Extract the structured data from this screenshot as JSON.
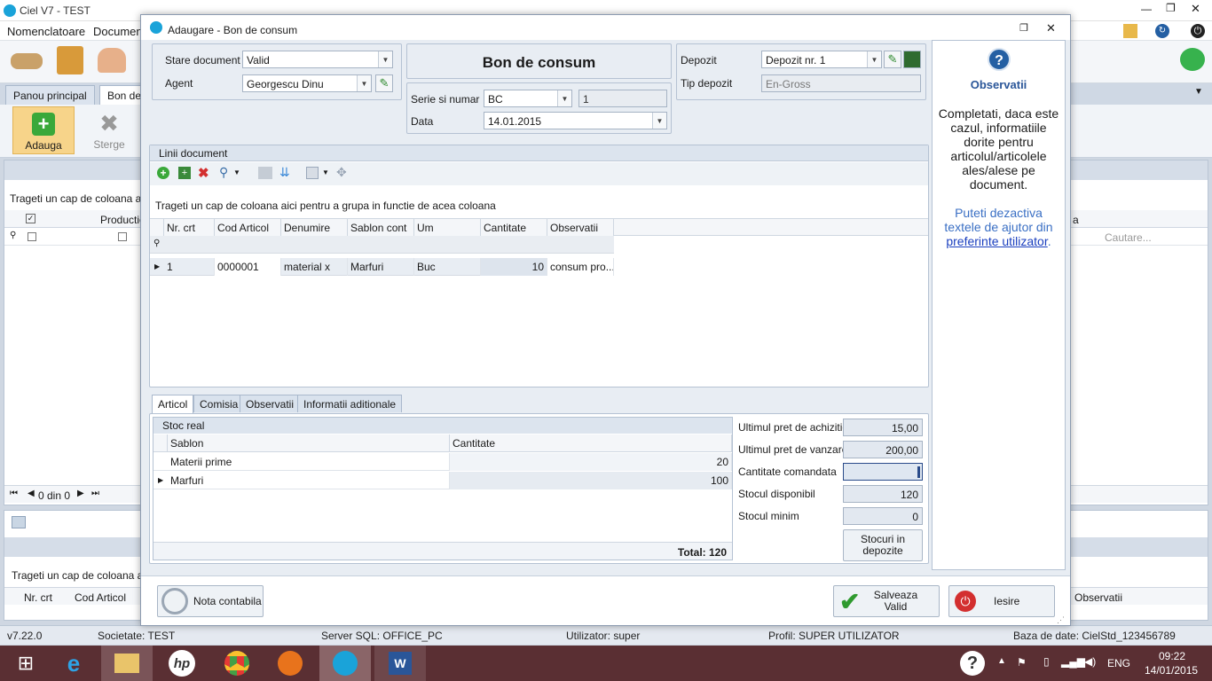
{
  "app": {
    "title": "Ciel V7 - TEST",
    "menu": [
      "Nomenclatoare",
      "Documen"
    ],
    "tabs": [
      "Panou principal",
      "Bon de c"
    ],
    "ribbon": {
      "add_label": "Adauga",
      "delete_label": "Sterge"
    },
    "left_panel": {
      "group_hint": "Trageti un cap de coloana aici p",
      "column_productie": "Productie",
      "nav_text": "0 din 0",
      "search_placeholder": "Cautare...",
      "right_col_fragment": "a"
    },
    "left_panel2": {
      "group_hint": "Trageti un cap de coloana aici",
      "col_nr_crt": "Nr. crt",
      "col_cod": "Cod Articol",
      "col_obs": "Observatii"
    },
    "status": {
      "version": "v7.22.0",
      "company": "Societate: TEST",
      "sql": "Server SQL: OFFICE_PC",
      "user": "Utilizator: super",
      "profile": "Profil: SUPER UTILIZATOR",
      "db": "Baza de date: CielStd_123456789"
    }
  },
  "dialog": {
    "title": "Adaugare - Bon de consum",
    "header": {
      "stare_label": "Stare document",
      "stare_value": "Valid",
      "agent_label": "Agent",
      "agent_value": "Georgescu Dinu",
      "doc_title": "Bon de consum",
      "serie_label": "Serie si numar",
      "serie_value": "BC",
      "numar_value": "1",
      "data_label": "Data",
      "data_value": "14.01.2015",
      "depozit_label": "Depozit",
      "depozit_value": "Depozit nr. 1",
      "tip_depozit_label": "Tip depozit",
      "tip_depozit_value": "En-Gross"
    },
    "lines": {
      "section_title": "Linii document",
      "group_hint": "Trageti un cap de coloana aici pentru a grupa in functie de acea coloana",
      "columns": [
        "Nr. crt",
        "Cod Articol",
        "Denumire",
        "Sablon cont",
        "Um",
        "Cantitate",
        "Observatii"
      ],
      "rows": [
        {
          "nr": "1",
          "cod": "0000001",
          "denumire": "material x",
          "sablon": "Marfuri",
          "um": "Buc",
          "cantitate": "10",
          "obs": "consum pro..."
        }
      ]
    },
    "bottom_tabs": [
      "Articol",
      "Comisia",
      "Observatii",
      "Informatii aditionale"
    ],
    "stock": {
      "title": "Stoc real",
      "columns": [
        "Sablon",
        "Cantitate"
      ],
      "rows": [
        {
          "sablon": "Materii prime",
          "cantitate": "20"
        },
        {
          "sablon": "Marfuri",
          "cantitate": "100"
        }
      ],
      "total": "Total: 120"
    },
    "prices": {
      "achizitie_label": "Ultimul pret de achizitie",
      "achizitie_value": "15,00",
      "vanzare_label": "Ultimul pret de vanzare",
      "vanzare_value": "200,00",
      "comandata_label": "Cantitate comandata",
      "comandata_value": "",
      "disponibil_label": "Stocul disponibil",
      "disponibil_value": "120",
      "minim_label": "Stocul minim",
      "minim_value": "0",
      "stocuri_btn": "Stocuri in depozite"
    },
    "observatii": {
      "title": "Observatii",
      "text": "Completati, daca este cazul, informatiile dorite pentru articolul/articolele ales/alese pe document.",
      "text2": "Puteti dezactiva textele de ajutor din",
      "link": "preferinte utilizator",
      "period": "."
    },
    "footer": {
      "nota_label": "Nota contabila",
      "save_line1": "Salveaza",
      "save_line2": "Valid",
      "exit_label": "Iesire"
    }
  },
  "taskbar": {
    "lang": "ENG",
    "time": "09:22",
    "date": "14/01/2015"
  }
}
